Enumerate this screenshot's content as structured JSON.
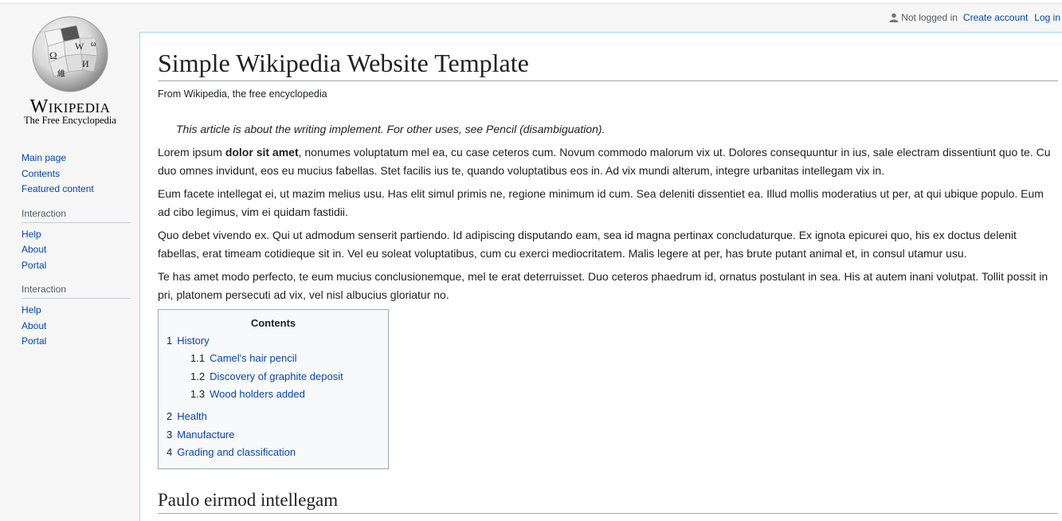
{
  "logo": {
    "wordmark": "Wikipedia",
    "tagline": "The Free Encyclopedia"
  },
  "personal_tools": {
    "status": "Not logged in",
    "create_account": "Create account",
    "log_in": "Log in"
  },
  "sidebar": {
    "nav": [
      "Main page",
      "Contents",
      "Featured content"
    ],
    "portals": [
      {
        "heading": "Interaction",
        "items": [
          "Help",
          "About",
          "Portal"
        ]
      },
      {
        "heading": "Interaction",
        "items": [
          "Help",
          "About",
          "Portal"
        ]
      }
    ]
  },
  "article": {
    "title": "Simple Wikipedia Website Template",
    "site_sub": "From Wikipedia, the free encyclopedia",
    "hatnote": "This article is about the writing implement. For other uses, see Pencil (disambiguation).",
    "p1_before_bold": "Lorem ipsum ",
    "p1_bold": "dolor sit amet",
    "p1_after_bold": ", nonumes voluptatum mel ea, cu case ceteros cum. Novum commodo malorum vix ut. Dolores consequuntur in ius, sale electram dissentiunt quo te. Cu duo omnes invidunt, eos eu mucius fabellas. Stet facilis ius te, quando voluptatibus eos in. Ad vix mundi alterum, integre urbanitas intellegam vix in.",
    "p2": "Eum facete intellegat ei, ut mazim melius usu. Has elit simul primis ne, regione minimum id cum. Sea deleniti dissentiet ea. Illud mollis moderatius ut per, at qui ubique populo. Eum ad cibo legimus, vim ei quidam fastidii.",
    "p3": "Quo debet vivendo ex. Qui ut admodum senserit partiendo. Id adipiscing disputando eam, sea id magna pertinax concludaturque. Ex ignota epicurei quo, his ex doctus delenit fabellas, erat timeam cotidieque sit in. Vel eu soleat voluptatibus, cum cu exerci mediocritatem. Malis legere at per, has brute putant animal et, in consul utamur usu.",
    "p4": "Te has amet modo perfecto, te eum mucius conclusionemque, mel te erat deterruisset. Duo ceteros phaedrum id, ornatus postulant in sea. His at autem inani volutpat. Tollit possit in pri, platonem persecuti ad vix, vel nisl albucius gloriatur no.",
    "section_heading": "Paulo eirmod intellegam"
  },
  "toc": {
    "title": "Contents",
    "items": [
      {
        "num": "1",
        "label": "History"
      },
      {
        "num": "1.1",
        "label": "Camel's hair pencil"
      },
      {
        "num": "1.2",
        "label": "Discovery of graphite deposit"
      },
      {
        "num": "1.3",
        "label": "Wood holders added"
      },
      {
        "num": "2",
        "label": "Health"
      },
      {
        "num": "3",
        "label": "Manufacture"
      },
      {
        "num": "4",
        "label": "Grading and classification"
      }
    ]
  },
  "icons": {
    "user": "user-icon",
    "globe": "wikipedia-globe-icon"
  }
}
